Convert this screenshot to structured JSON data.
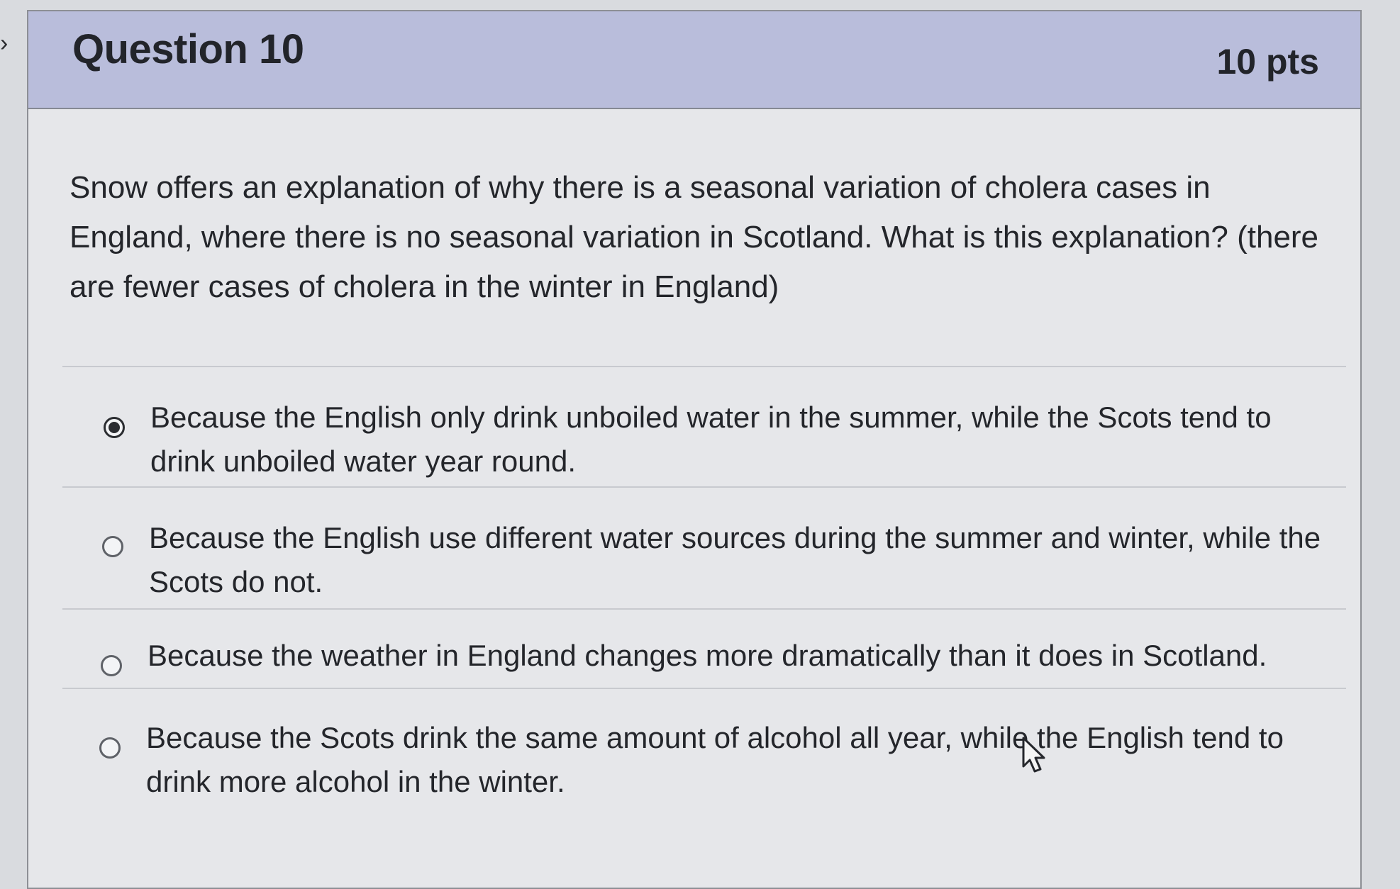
{
  "question": {
    "title": "Question 10",
    "points": "10 pts",
    "text": "Snow offers an explanation of why there is a seasonal variation of cholera cases in England, where there is no seasonal variation in Scotland.  What is this explanation? (there are fewer cases of cholera in the winter in England)"
  },
  "answers": [
    {
      "label": "Because the English only drink unboiled water in the summer, while the Scots tend to drink unboiled water year round.",
      "selected": true
    },
    {
      "label": "Because the English use different water sources during the summer and winter, while the Scots do not.",
      "selected": false
    },
    {
      "label": "Because the weather in England changes more dramatically than it does in Scotland.",
      "selected": false
    },
    {
      "label": "Because the Scots drink the same amount of alcohol all year, while the English tend to drink more alcohol in the winter.",
      "selected": false
    }
  ],
  "colors": {
    "header_background": "#b9bddb",
    "card_background": "#e6e7ea",
    "text": "#24262b"
  },
  "icons": {
    "previous": "chevron-left-icon",
    "pointer": "mouse-pointer-icon"
  }
}
